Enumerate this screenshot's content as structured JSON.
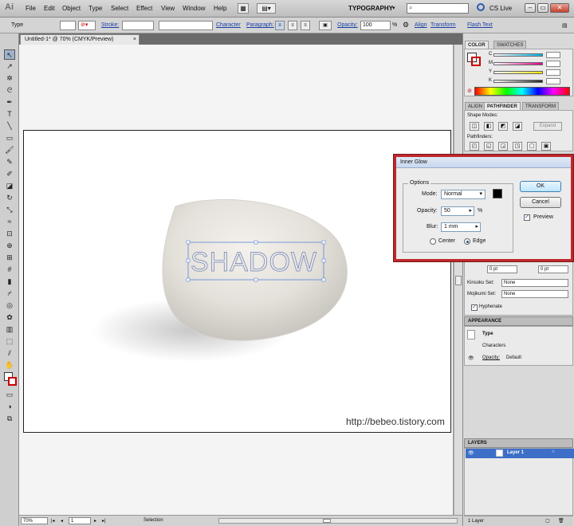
{
  "app": {
    "logo": "Ai",
    "menus": [
      "File",
      "Edit",
      "Object",
      "Type",
      "Select",
      "Effect",
      "View",
      "Window",
      "Help"
    ],
    "workspace": "TYPOGRAPHY",
    "cs_live": "CS Live"
  },
  "control_bar": {
    "selection_type": "Type",
    "stroke_label": "Stroke:",
    "character_link": "Character",
    "paragraph_link": "Paragraph:",
    "opacity_label": "Opacity:",
    "opacity_value": "100",
    "opacity_unit": "%",
    "align_link": "Align",
    "transform_link": "Transform",
    "flash_text_link": "Flash Text"
  },
  "document": {
    "tab_title": "Untitled-1* @ 70% (CMYK/Preview)",
    "tab_close": "×",
    "watermark": "http://bebeo.tistory.com",
    "headline_text": "SHADOW"
  },
  "status_bar": {
    "zoom": "70%",
    "artboard": "1",
    "tool": "Selection"
  },
  "color_panel": {
    "tab_color": "COLOR",
    "tab_swatches": "SWATCHES",
    "channels": [
      {
        "label": "C",
        "color": "#00b4e8"
      },
      {
        "label": "M",
        "color": "#e8008c"
      },
      {
        "label": "Y",
        "color": "#f0e600"
      },
      {
        "label": "K",
        "color": "#222222"
      }
    ]
  },
  "pathfinder_panel": {
    "tab_align": "ALIGN",
    "tab_pathfinder": "PATHFINDER",
    "tab_transform": "TRANSFORM",
    "shape_modes_label": "Shape Modes:",
    "expand_label": "Expand",
    "pathfinders_label": "Pathfinders:"
  },
  "character_panel": {
    "kinsoku_label": "Kinsoku Set:",
    "kinsoku_value": "None",
    "mojikumi_label": "Mojikumi Set:",
    "mojikumi_value": "None",
    "hyphenate_label": "Hyphenate",
    "pt_left": "0 pt",
    "pt_right": "0 pt"
  },
  "appearance_panel": {
    "title": "APPEARANCE",
    "type_label": "Type",
    "characters_label": "Characters",
    "opacity_label": "Opacity:",
    "opacity_value": "Default"
  },
  "layers_panel": {
    "title": "LAYERS",
    "layer_name": "Layer 1",
    "footer": "1 Layer"
  },
  "inner_glow_dialog": {
    "title": "Inner Glow",
    "options_label": "Options",
    "mode_label": "Mode:",
    "mode_value": "Normal",
    "opacity_label": "Opacity:",
    "opacity_value": "50",
    "opacity_unit": "%",
    "blur_label": "Blur:",
    "blur_value": "1 mm",
    "center_label": "Center",
    "edge_label": "Edge",
    "ok_label": "OK",
    "cancel_label": "Cancel",
    "preview_label": "Preview",
    "glow_color": "#000000",
    "edge_selected": true,
    "preview_checked": true
  }
}
